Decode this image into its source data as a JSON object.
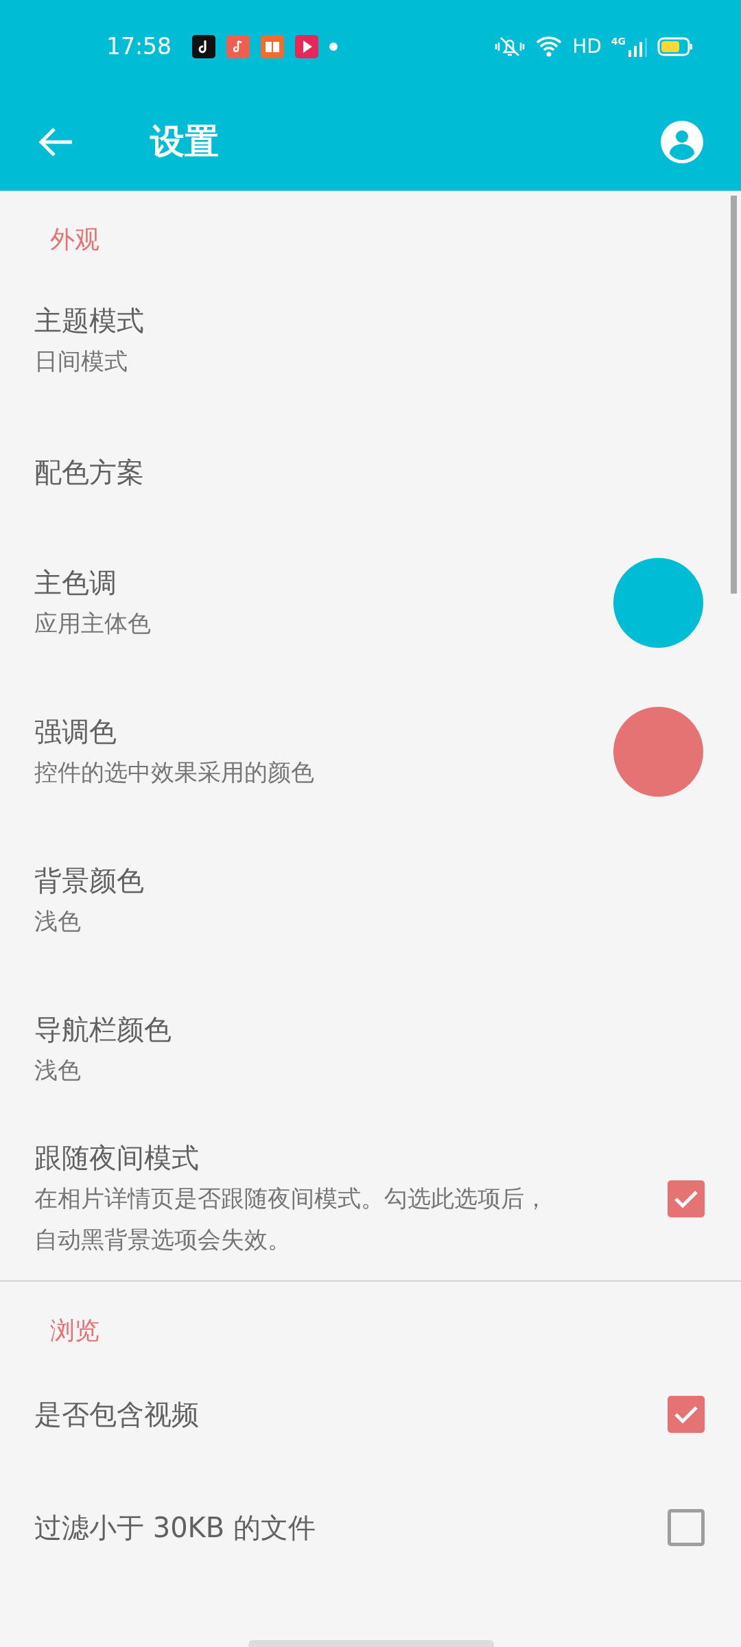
{
  "status_bar": {
    "time": "17:58",
    "hd": "HD",
    "network": "4G"
  },
  "app_bar": {
    "title": "设置"
  },
  "sections": [
    {
      "header": "外观",
      "divider": true,
      "items": [
        {
          "kind": "text",
          "title": "主题模式",
          "subtitle": "日间模式"
        },
        {
          "kind": "text",
          "title": "配色方案"
        },
        {
          "kind": "color",
          "title": "主色调",
          "subtitle": "应用主体色",
          "color": "#00bcd4"
        },
        {
          "kind": "color",
          "title": "强调色",
          "subtitle": "控件的选中效果采用的颜色",
          "color": "#e57373"
        },
        {
          "kind": "text",
          "title": "背景颜色",
          "subtitle": "浅色"
        },
        {
          "kind": "text",
          "title": "导航栏颜色",
          "subtitle": "浅色"
        },
        {
          "kind": "checkbox",
          "title": "跟随夜间模式",
          "subtitle": "在相片详情页是否跟随夜间模式。勾选此选项后，自动黑背景选项会失效。",
          "checked": true
        }
      ]
    },
    {
      "header": "浏览",
      "divider": false,
      "items": [
        {
          "kind": "checkbox",
          "title": "是否包含视频",
          "checked": true
        },
        {
          "kind": "checkbox",
          "title": "过滤小于 30KB 的文件",
          "checked": false
        }
      ]
    }
  ]
}
